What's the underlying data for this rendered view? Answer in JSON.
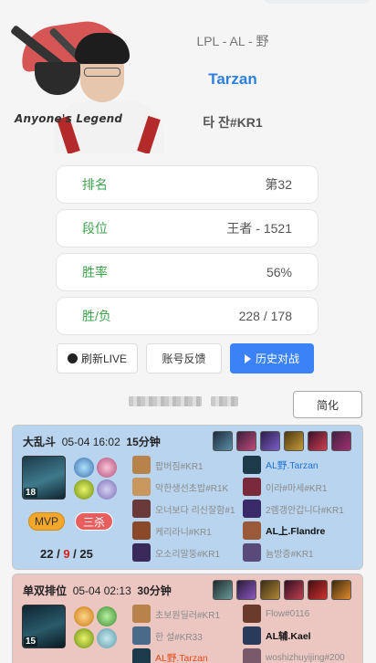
{
  "profile": {
    "brand_text": "Anyone's Legend",
    "league": "LPL - AL - 野",
    "name": "Tarzan",
    "id": "타 잔#KR1"
  },
  "stats": [
    {
      "label": "排名",
      "value": "第32"
    },
    {
      "label": "段位",
      "value": "王者 - 1521"
    },
    {
      "label": "胜率",
      "value": "56%"
    },
    {
      "label": "胜/负",
      "value": "228 / 178"
    }
  ],
  "actions": {
    "refresh": "刷新LIVE",
    "feedback": "账号反馈",
    "history": "历史对战",
    "simplify": "简化"
  },
  "matches": [
    {
      "mode": "大乱斗",
      "date": "05-04 16:02",
      "duration": "15分钟",
      "level": "18",
      "badges": [
        "MVP",
        "三杀"
      ],
      "kda": {
        "k": "22",
        "d": "9",
        "a": "25"
      },
      "team_left": [
        "팝버짐#KR1",
        "악한생선초밥#R1K",
        "오너보다 리신잘함#1",
        "케리라니#KR1",
        "오소리말뚱#KR1"
      ],
      "team_right": [
        "AL野.Tarzan",
        "이라#마세#KR1",
        "2렘갱안갑니다#KR1",
        "AL上.Flandre",
        "늄방증#KR1"
      ],
      "colors": {
        "bg": "#b9d4ee"
      }
    },
    {
      "mode": "单双排位",
      "date": "05-04 02:13",
      "duration": "30分钟",
      "level": "15",
      "team_left": [
        "초보원딜러#KR1",
        "한 설#KR33",
        "AL野.Tarzan"
      ],
      "team_right": [
        "Flow#0116",
        "AL辅.Kael",
        "woshizhuyijing#200"
      ],
      "colors": {
        "bg": "#ecc7c2"
      }
    }
  ],
  "colors": {
    "accent": "#2d7fe0",
    "label_green": "#3fa34d",
    "history_button": "#3b82f6"
  }
}
